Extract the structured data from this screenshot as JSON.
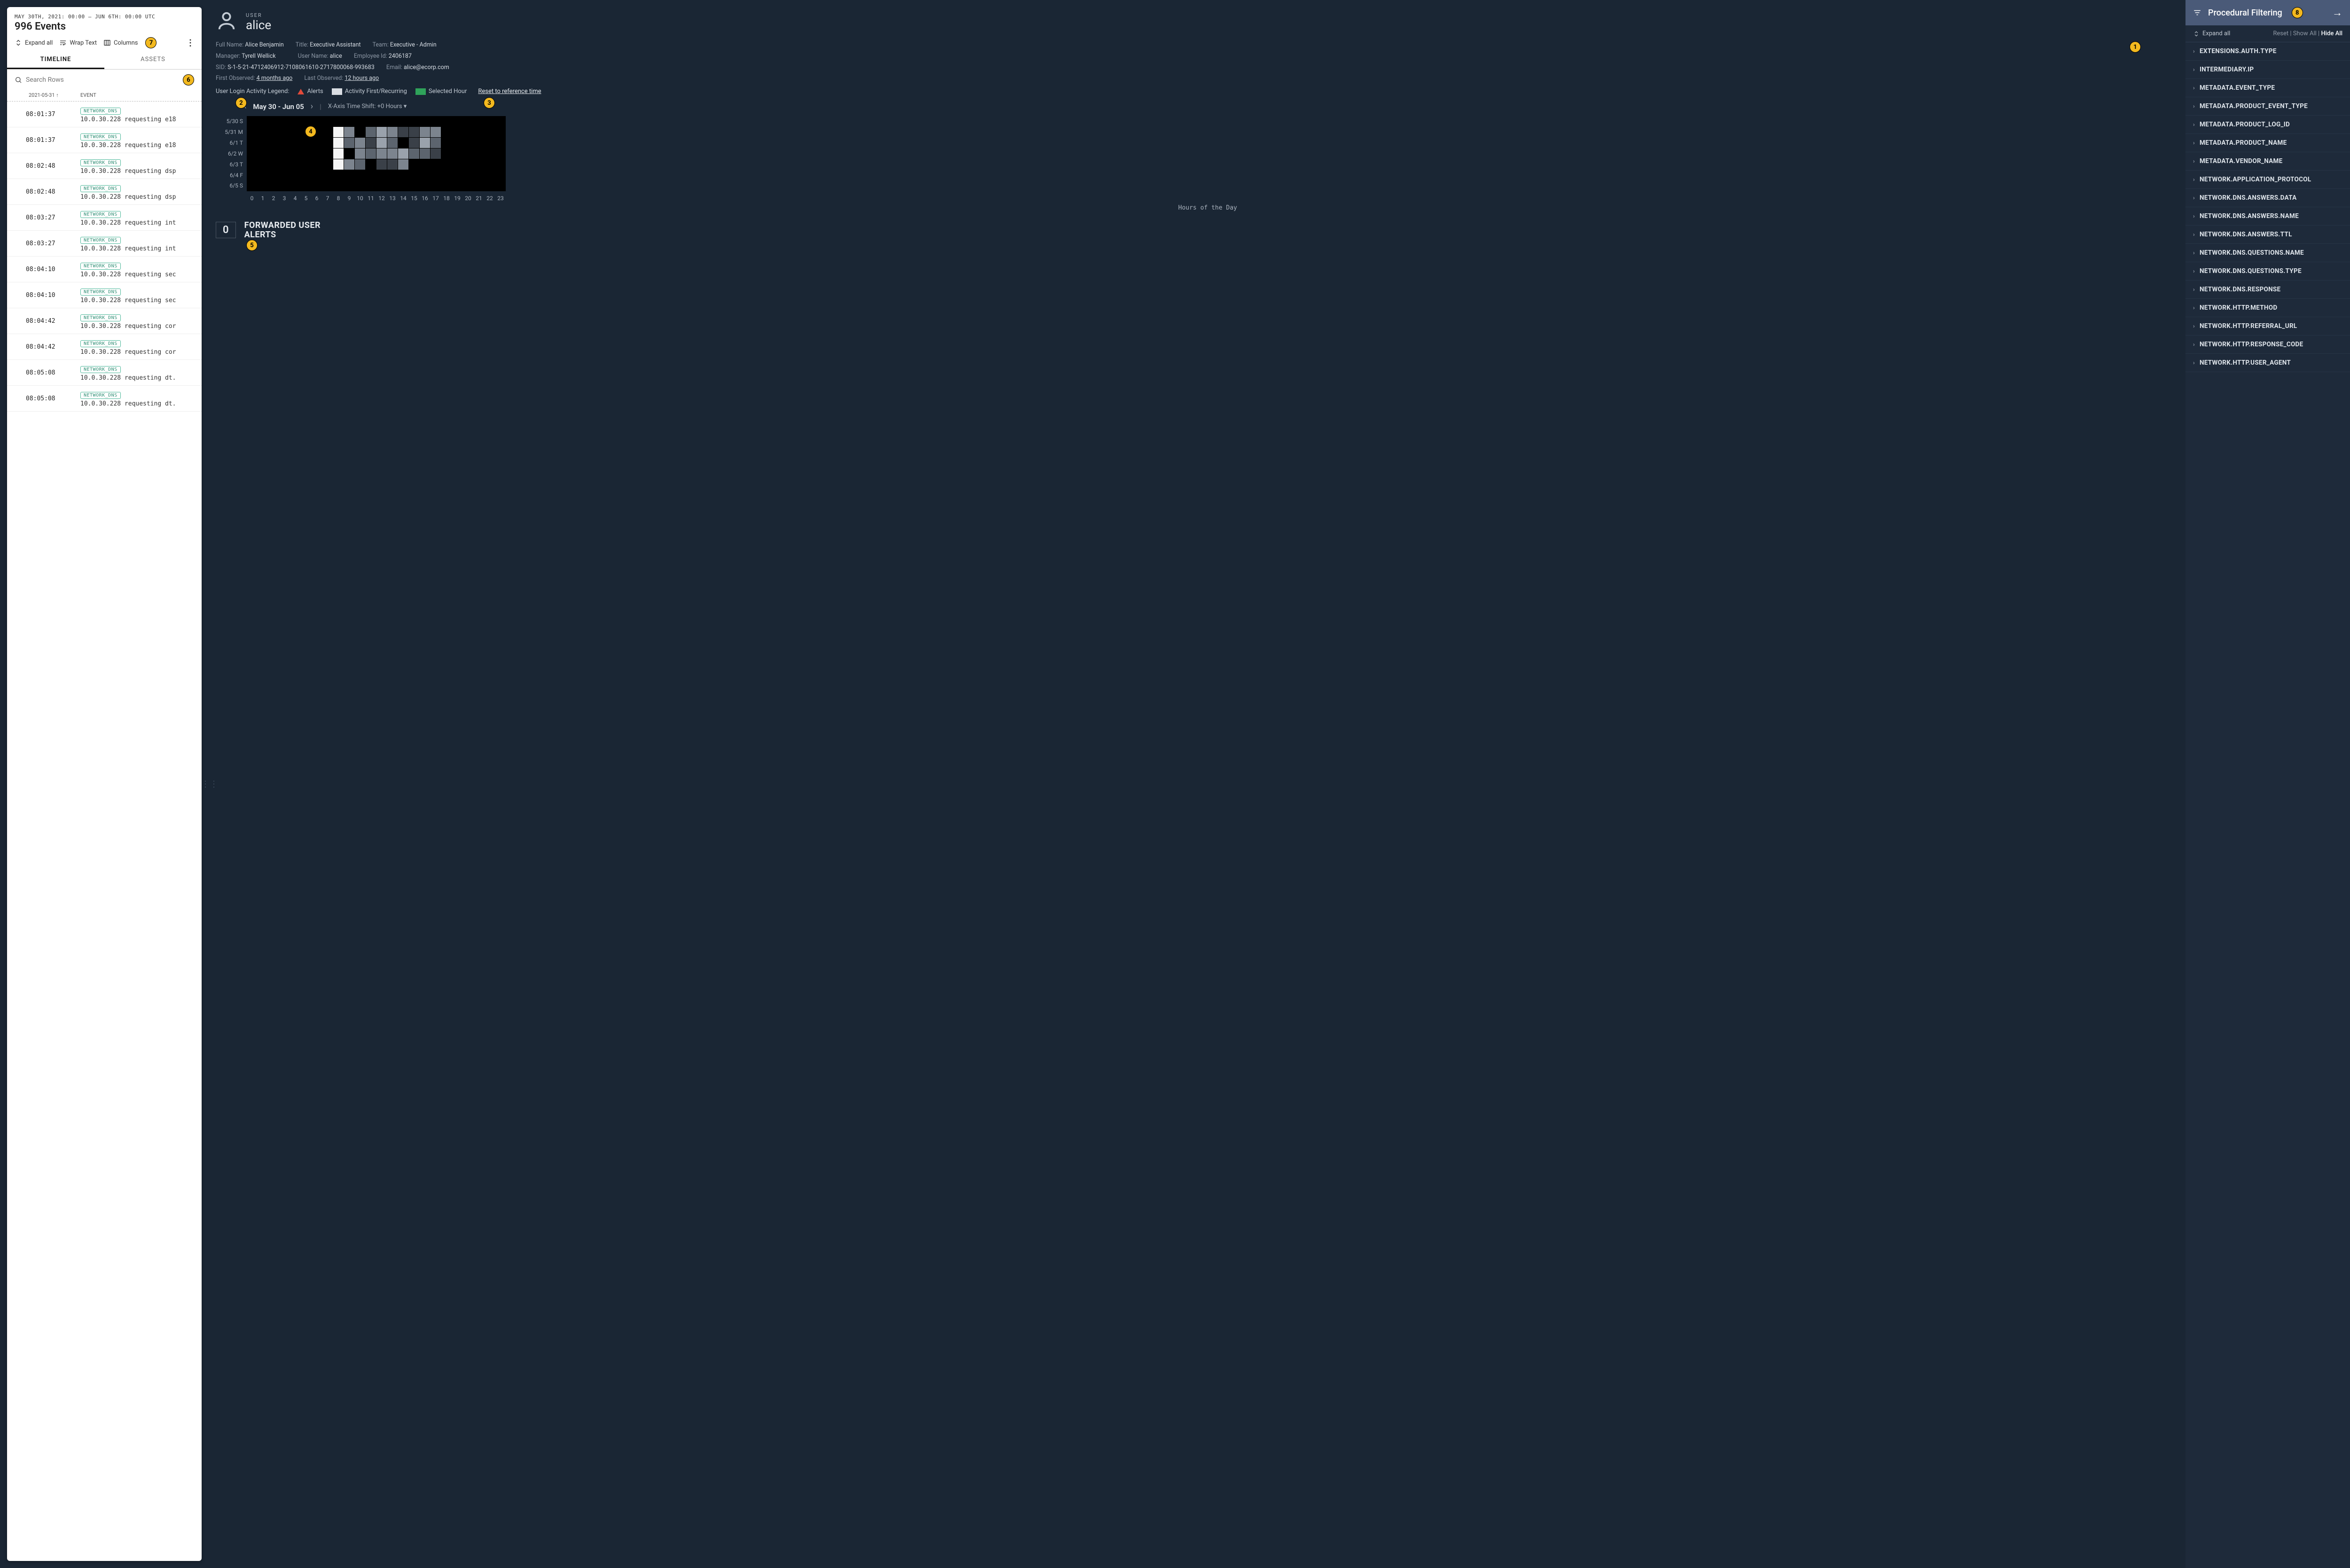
{
  "left": {
    "range": "MAY 30TH, 2021: 00:00 — JUN 6TH: 00:00 UTC",
    "count": "996 Events",
    "tools": {
      "expand": "Expand all",
      "wrap": "Wrap Text",
      "columns": "Columns"
    },
    "tabs": {
      "timeline": "TIMELINE",
      "assets": "ASSETS"
    },
    "search_placeholder": "Search Rows",
    "col_date": "2021-05-31 ↑",
    "col_event": "EVENT",
    "rows": [
      {
        "t": "08:01:37",
        "tag": "NETWORK_DNS",
        "d": "10.0.30.228 requesting e18"
      },
      {
        "t": "08:01:37",
        "tag": "NETWORK_DNS",
        "d": "10.0.30.228 requesting e18"
      },
      {
        "t": "08:02:48",
        "tag": "NETWORK_DNS",
        "d": "10.0.30.228 requesting dsp"
      },
      {
        "t": "08:02:48",
        "tag": "NETWORK_DNS",
        "d": "10.0.30.228 requesting dsp"
      },
      {
        "t": "08:03:27",
        "tag": "NETWORK_DNS",
        "d": "10.0.30.228 requesting int"
      },
      {
        "t": "08:03:27",
        "tag": "NETWORK_DNS",
        "d": "10.0.30.228 requesting int"
      },
      {
        "t": "08:04:10",
        "tag": "NETWORK_DNS",
        "d": "10.0.30.228 requesting sec"
      },
      {
        "t": "08:04:10",
        "tag": "NETWORK_DNS",
        "d": "10.0.30.228 requesting sec"
      },
      {
        "t": "08:04:42",
        "tag": "NETWORK_DNS",
        "d": "10.0.30.228 requesting cor"
      },
      {
        "t": "08:04:42",
        "tag": "NETWORK_DNS",
        "d": "10.0.30.228 requesting cor"
      },
      {
        "t": "08:05:08",
        "tag": "NETWORK_DNS",
        "d": "10.0.30.228 requesting dt."
      },
      {
        "t": "08:05:08",
        "tag": "NETWORK_DNS",
        "d": "10.0.30.228 requesting dt."
      }
    ]
  },
  "user": {
    "label": "USER",
    "name": "alice",
    "fields": {
      "full_name_l": "Full Name:",
      "full_name": "Alice Benjamin",
      "title_l": "Title:",
      "title": "Executive Assistant",
      "team_l": "Team:",
      "team": "Executive - Admin",
      "manager_l": "Manager:",
      "manager": "Tyrell Wellick",
      "username_l": "User Name:",
      "username": "alice",
      "empid_l": "Employee Id:",
      "empid": "2406187",
      "sid_l": "SID:",
      "sid": "S-1-5-21-4712406912-7108061610-2717800068-993683",
      "email_l": "Email:",
      "email": "alice@ecorp.com",
      "first_l": "First Observed:",
      "first": "4 months ago",
      "last_l": "Last Observed:",
      "last": "12 hours ago"
    }
  },
  "legend": {
    "title": "User Login Activity Legend:",
    "alerts": "Alerts",
    "activity": "Activity First/Recurring",
    "selected": "Selected Hour",
    "reset": "Reset to reference time"
  },
  "nav": {
    "range": "May 30 - Jun 05",
    "shift_l": "X-Axis Time Shift:",
    "shift_v": "+0 Hours"
  },
  "chart_data": {
    "type": "heatmap",
    "title": "User Login Activity",
    "xlabel": "Hours of the Day",
    "x": [
      0,
      1,
      2,
      3,
      4,
      5,
      6,
      7,
      8,
      9,
      10,
      11,
      12,
      13,
      14,
      15,
      16,
      17,
      18,
      19,
      20,
      21,
      22,
      23
    ],
    "y": [
      "5/30 S",
      "5/31 M",
      "6/1 T",
      "6/2 W",
      "6/3 T",
      "6/4 F",
      "6/5 S"
    ],
    "values": [
      [
        0,
        0,
        0,
        0,
        0,
        0,
        0,
        0,
        0,
        0,
        0,
        0,
        0,
        0,
        0,
        0,
        0,
        0,
        0,
        0,
        0,
        0,
        0,
        0
      ],
      [
        0,
        0,
        0,
        0,
        0,
        0,
        0,
        0,
        10,
        4,
        0,
        3,
        5,
        4,
        2,
        2,
        4,
        4,
        0,
        0,
        0,
        0,
        0,
        0
      ],
      [
        0,
        0,
        0,
        0,
        0,
        0,
        0,
        0,
        10,
        3,
        4,
        2,
        5,
        3,
        0,
        2,
        5,
        3,
        0,
        0,
        0,
        0,
        0,
        0
      ],
      [
        0,
        0,
        0,
        0,
        0,
        0,
        0,
        0,
        10,
        0,
        4,
        3,
        4,
        4,
        5,
        3,
        3,
        2,
        0,
        0,
        0,
        0,
        0,
        0
      ],
      [
        0,
        0,
        0,
        0,
        0,
        0,
        0,
        0,
        10,
        4,
        3,
        0,
        2,
        2,
        4,
        0,
        0,
        0,
        0,
        0,
        0,
        0,
        0,
        0
      ],
      [
        0,
        0,
        0,
        0,
        0,
        0,
        0,
        0,
        0,
        0,
        0,
        0,
        0,
        0,
        0,
        0,
        0,
        0,
        0,
        0,
        0,
        0,
        0,
        0
      ],
      [
        0,
        0,
        0,
        0,
        0,
        0,
        0,
        0,
        0,
        0,
        0,
        0,
        0,
        0,
        0,
        0,
        0,
        0,
        0,
        0,
        0,
        0,
        0,
        0
      ]
    ],
    "scale": [
      "#000000",
      "#3a4048",
      "#5c646e",
      "#7c848e",
      "#9aa2ac",
      "#f5f5f5"
    ]
  },
  "alerts": {
    "count": "0",
    "label": "FORWARDED USER ALERTS"
  },
  "right": {
    "title": "Procedural Filtering",
    "expand": "Expand all",
    "reset": "Reset",
    "show": "Show All",
    "hide": "Hide All",
    "items": [
      "EXTENSIONS.AUTH.TYPE",
      "INTERMEDIARY.IP",
      "METADATA.EVENT_TYPE",
      "METADATA.PRODUCT_EVENT_TYPE",
      "METADATA.PRODUCT_LOG_ID",
      "METADATA.PRODUCT_NAME",
      "METADATA.VENDOR_NAME",
      "NETWORK.APPLICATION_PROTOCOL",
      "NETWORK.DNS.ANSWERS.DATA",
      "NETWORK.DNS.ANSWERS.NAME",
      "NETWORK.DNS.ANSWERS.TTL",
      "NETWORK.DNS.QUESTIONS.NAME",
      "NETWORK.DNS.QUESTIONS.TYPE",
      "NETWORK.DNS.RESPONSE",
      "NETWORK.HTTP.METHOD",
      "NETWORK.HTTP.REFERRAL_URL",
      "NETWORK.HTTP.RESPONSE_CODE",
      "NETWORK.HTTP.USER_AGENT"
    ]
  },
  "callouts": {
    "1": "1",
    "2": "2",
    "3": "3",
    "4": "4",
    "5": "5",
    "6": "6",
    "7": "7",
    "8": "8"
  }
}
